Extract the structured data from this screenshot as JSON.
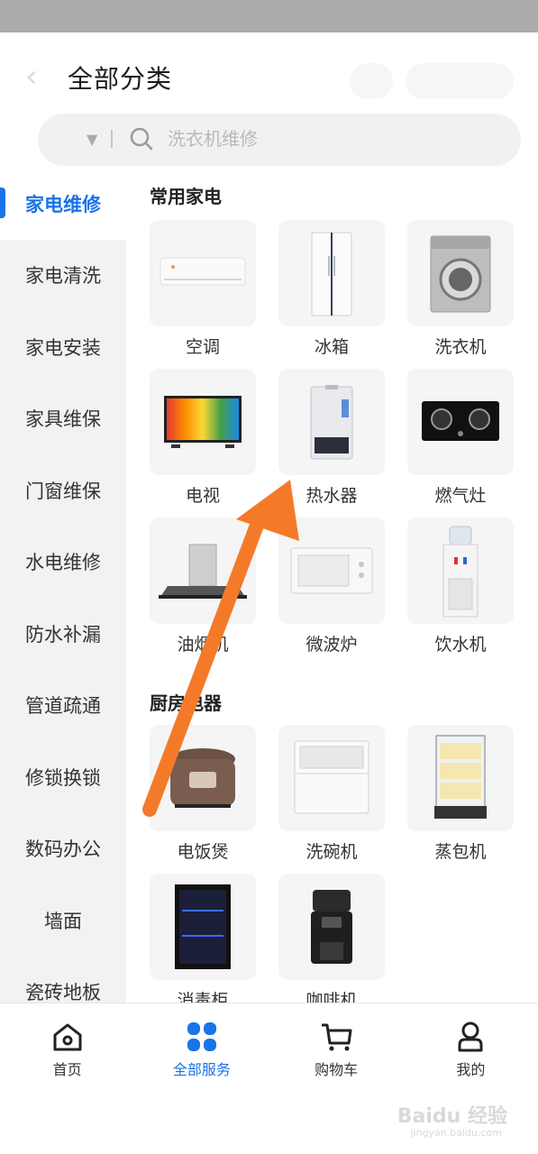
{
  "header": {
    "title": "全部分类",
    "search_placeholder": "洗衣机维修"
  },
  "sidebar": {
    "items": [
      {
        "label": "家电维修"
      },
      {
        "label": "家电清洗"
      },
      {
        "label": "家电安装"
      },
      {
        "label": "家具维保"
      },
      {
        "label": "门窗维保"
      },
      {
        "label": "水电维修"
      },
      {
        "label": "防水补漏"
      },
      {
        "label": "管道疏通"
      },
      {
        "label": "修锁换锁"
      },
      {
        "label": "数码办公"
      },
      {
        "label": "墙面"
      },
      {
        "label": "瓷砖地板"
      }
    ]
  },
  "sections": [
    {
      "title": "常用家电",
      "products": [
        {
          "label": "空调",
          "icon": "air-conditioner"
        },
        {
          "label": "冰箱",
          "icon": "refrigerator"
        },
        {
          "label": "洗衣机",
          "icon": "washing-machine"
        },
        {
          "label": "电视",
          "icon": "television"
        },
        {
          "label": "热水器",
          "icon": "water-heater"
        },
        {
          "label": "燃气灶",
          "icon": "gas-stove"
        },
        {
          "label": "油烟机",
          "icon": "range-hood"
        },
        {
          "label": "微波炉",
          "icon": "microwave"
        },
        {
          "label": "饮水机",
          "icon": "water-dispenser"
        }
      ]
    },
    {
      "title": "厨房电器",
      "products": [
        {
          "label": "电饭煲",
          "icon": "rice-cooker"
        },
        {
          "label": "洗碗机",
          "icon": "dishwasher"
        },
        {
          "label": "蒸包机",
          "icon": "bun-steamer"
        },
        {
          "label": "消毒柜",
          "icon": "disinfection-cabinet"
        },
        {
          "label": "咖啡机",
          "icon": "coffee-machine"
        }
      ]
    }
  ],
  "tabbar": {
    "items": [
      {
        "label": "首页",
        "icon": "home"
      },
      {
        "label": "全部服务",
        "icon": "grid"
      },
      {
        "label": "购物车",
        "icon": "cart"
      },
      {
        "label": "我的",
        "icon": "profile"
      }
    ]
  },
  "watermark": {
    "text": "Baidu 经验",
    "url": "jingyan.baidu.com"
  },
  "colors": {
    "accent": "#1a73e8",
    "annotation_arrow": "#f47a2a"
  }
}
